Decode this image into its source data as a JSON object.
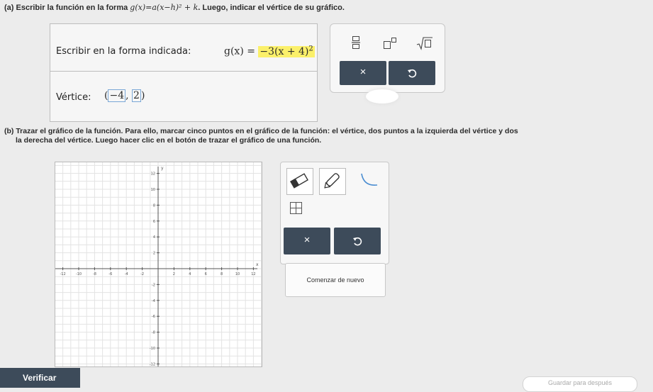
{
  "part_a": {
    "label": "(a)",
    "text1": "Escribir la función en la forma",
    "formula": "g(x)=a(x−h)² + k",
    "text2": ". Luego, indicar el vértice de su gráfico."
  },
  "answer": {
    "form_label": "Escribir en la forma indicada:",
    "g_prefix": "g(x) =",
    "g_highlight": "−3(x + 4)",
    "g_exponent": "2",
    "vertex_label": "Vértice:",
    "vertex_open": "(",
    "vertex_x": "−4",
    "vertex_sep": ",",
    "vertex_y": "2",
    "vertex_close": ")"
  },
  "math_toolbar": {
    "fraction_icon": "fraction-icon",
    "exponent_icon": "exponent-icon",
    "sqrt_icon": "square-root-icon",
    "clear_label": "×",
    "undo_icon": "undo-icon"
  },
  "part_b": {
    "label": "(b)",
    "line1": "Trazar el gráfico de la función. Para ello, marcar cinco puntos en el gráfico de la función: el vértice, dos puntos a la izquierda del vértice y dos",
    "line2": "la derecha del vértice. Luego hacer clic en el botón de trazar el gráfico de una función."
  },
  "graph": {
    "x_axis_label": "x",
    "y_axis_label": "y",
    "x_ticks": [
      "-12",
      "-10",
      "-8",
      "-6",
      "-4",
      "-2",
      "2",
      "4",
      "6",
      "8",
      "10",
      "12"
    ],
    "y_ticks": [
      "12",
      "10",
      "8",
      "6",
      "4",
      "2",
      "-2",
      "-4",
      "-6",
      "-8",
      "-10",
      "-12"
    ]
  },
  "graph_tools": {
    "eraser_icon": "eraser-icon",
    "pencil_icon": "pencil-icon",
    "curve_icon": "parabola-curve-icon",
    "table_icon": "table-icon",
    "clear_label": "×",
    "undo_icon": "undo-icon"
  },
  "reset_label": "Comenzar de nuevo",
  "verify_label": "Verificar",
  "save_later_label": "Guardar para después",
  "colors": {
    "dark_button": "#3d4b5a",
    "highlight": "#fbf06a"
  }
}
